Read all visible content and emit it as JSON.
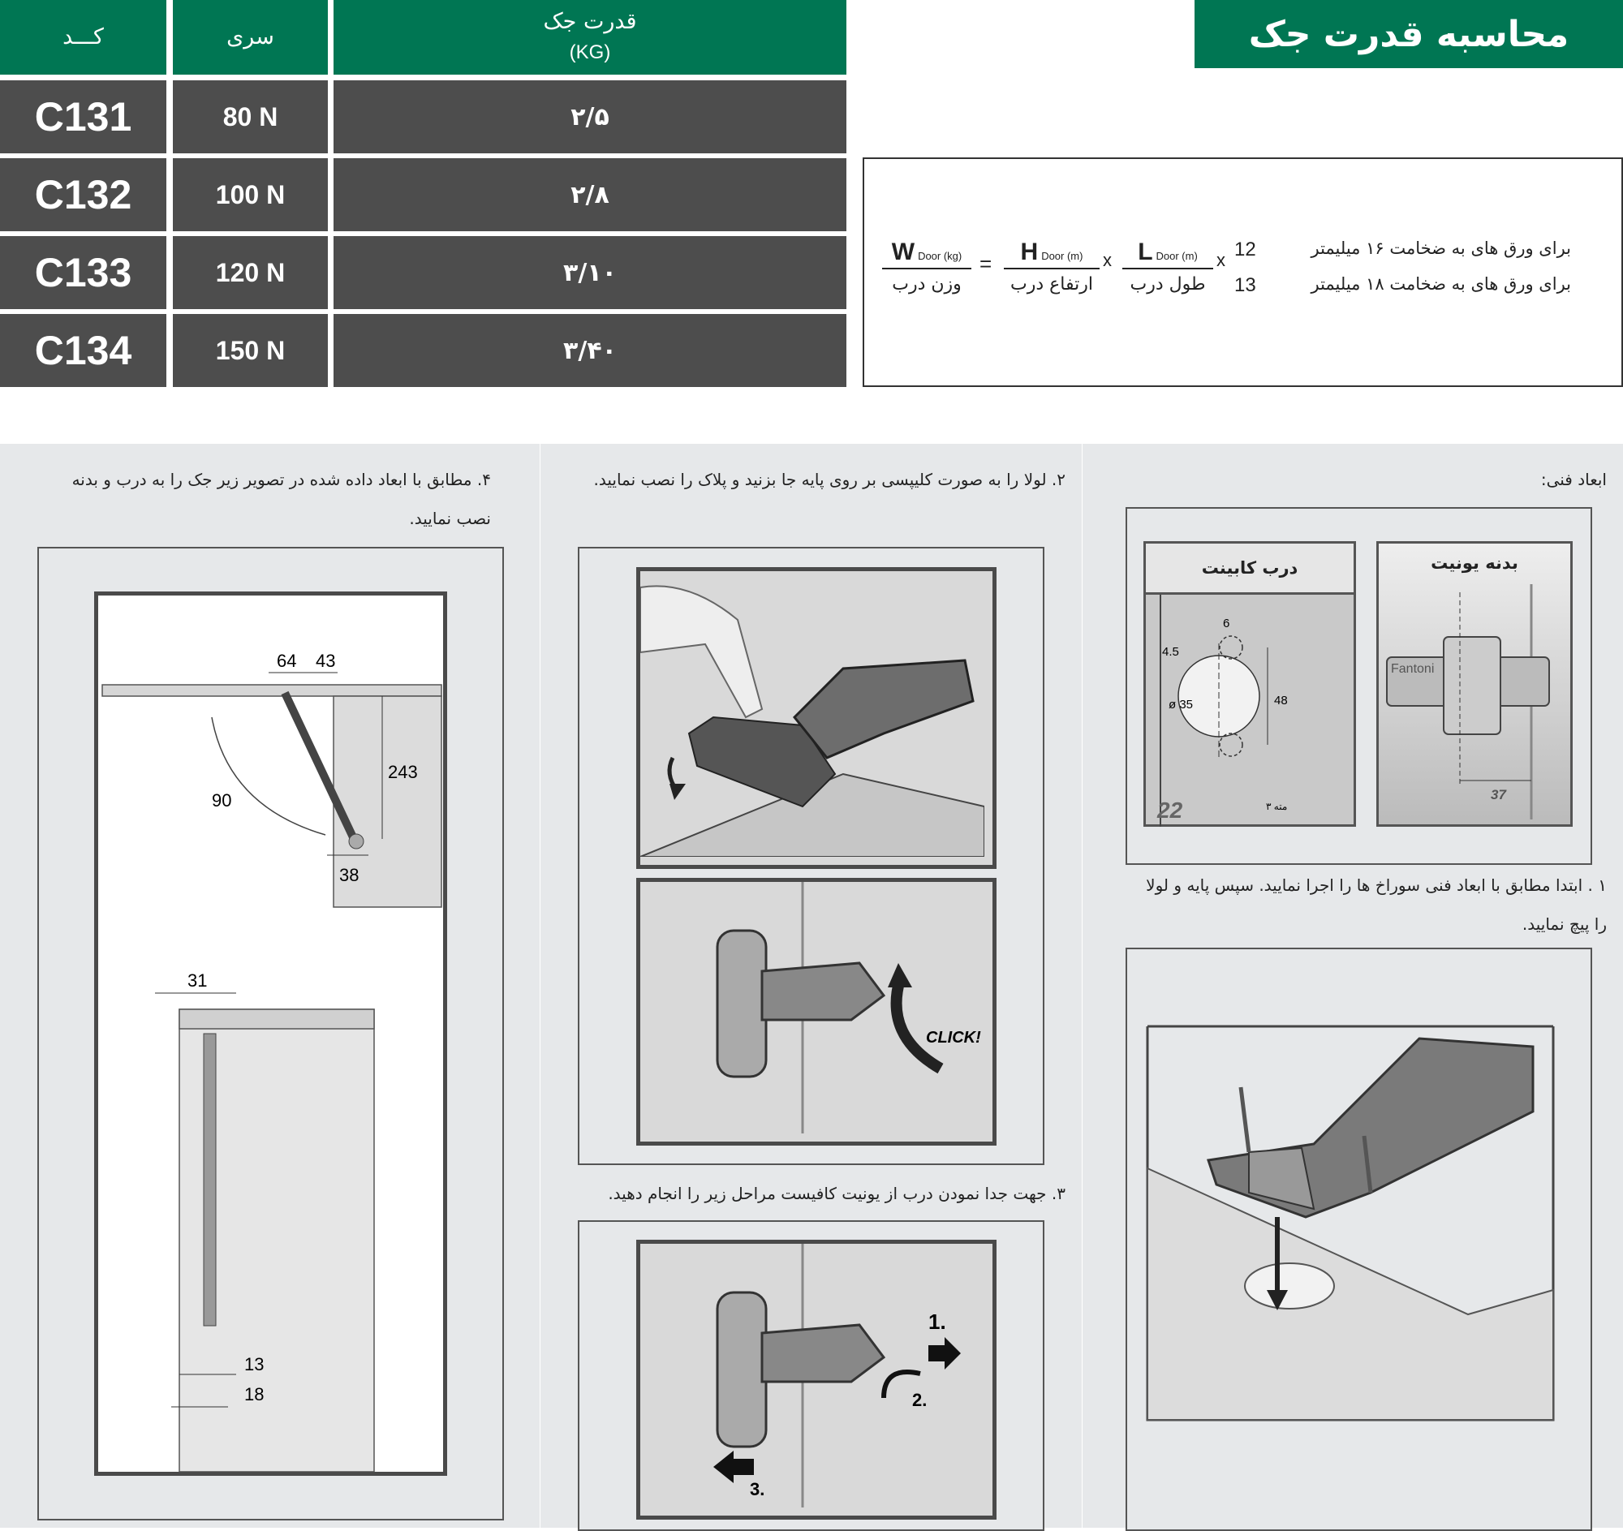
{
  "header": {
    "title": "محاسبه قدرت جک"
  },
  "table": {
    "headers": {
      "code": "کـــد",
      "series": "سری",
      "capacity": "قدرت جک",
      "capacity_unit": "(KG)"
    },
    "rows": [
      {
        "code": "C131",
        "series": "80 N",
        "capacity": "۲/۵"
      },
      {
        "code": "C132",
        "series": "100 N",
        "capacity": "۲/۸"
      },
      {
        "code": "C133",
        "series": "120 N",
        "capacity": "۳/۱۰"
      },
      {
        "code": "C134",
        "series": "150 N",
        "capacity": "۳/۴۰"
      }
    ]
  },
  "formula": {
    "w_symbol": "W",
    "w_sub": "Door (kg)",
    "w_label": "وزن درب",
    "equals": "=",
    "h_symbol": "H",
    "h_sub": "Door (m)",
    "h_label": "ارتفاع درب",
    "times": "x",
    "l_symbol": "L",
    "l_sub": "Door (m)",
    "l_label": "طول درب",
    "factor_12": "12",
    "factor_13": "13",
    "note_16": "برای ورق های به ضخامت ۱۶ میلیمتر",
    "note_18": "برای ورق های به ضخامت ۱۸ میلیمتر"
  },
  "panel_right": {
    "label": "ابعاد فنی:",
    "door_label": "درب کابینت",
    "body_label": "بدنه یونیت",
    "brand": "Fantoni",
    "dims": {
      "d6": "6",
      "d45": "4.5",
      "d35": "ø 35",
      "d48": "48",
      "d22": "22",
      "drill": "مته ۳",
      "d37": "37"
    },
    "step1": "۱ . ابتدا مطابق با ابعاد فنی سوراخ ها را اجرا نمایید. سپس پایه و لولا را پیچ نمایید."
  },
  "panel_middle": {
    "step2": "۲. لولا را به صورت کلیپسی بر روی پایه جا بزنید و پلاک را نصب نمایید.",
    "click": "CLICK!",
    "step3": "۳. جهت جدا نمودن درب از یونیت کافیست مراحل زیر را انجام دهید.",
    "n1": "1.",
    "n2": "2.",
    "n3": "3."
  },
  "panel_left": {
    "step4": "۴. مطابق با ابعاد داده شده در تصویر زیر جک را به درب و بدنه نصب نمایید.",
    "dims": {
      "d64": "64",
      "d43": "43",
      "d243": "243",
      "d90": "90",
      "d38": "38",
      "d31": "31",
      "d13": "13",
      "d18": "18"
    }
  }
}
